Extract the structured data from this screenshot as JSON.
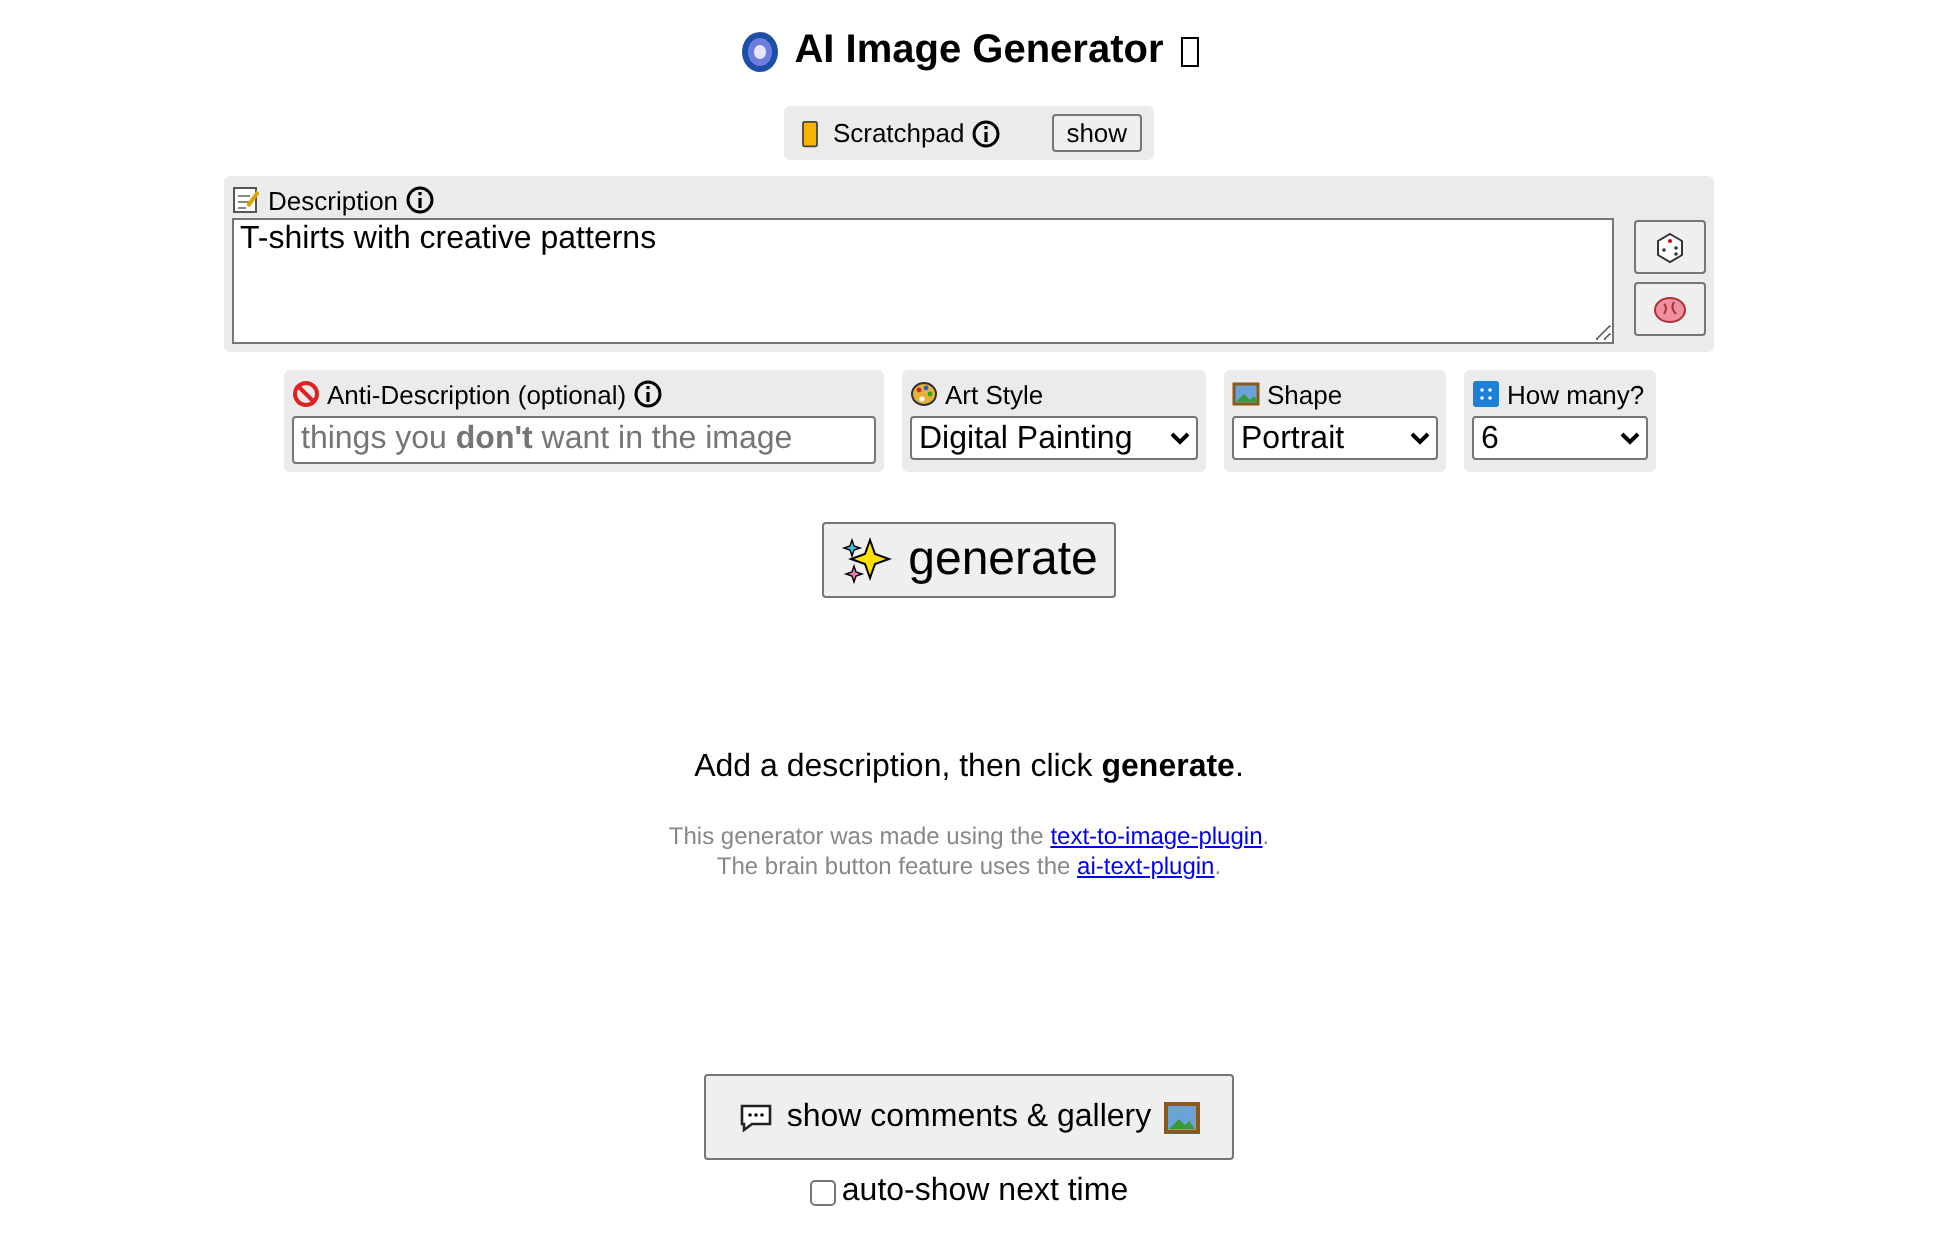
{
  "title": "AI Image Generator",
  "scratchpad": {
    "label": "Scratchpad",
    "button": "show"
  },
  "description": {
    "label": "Description",
    "value": "T-shirts with creative patterns"
  },
  "anti_description": {
    "label": "Anti-Description (optional)",
    "placeholder": "things you **don't** want in the image"
  },
  "art_style": {
    "label": "Art Style",
    "value": "Digital Painting"
  },
  "shape": {
    "label": "Shape",
    "value": "Portrait"
  },
  "how_many": {
    "label": "How many?",
    "value": "6"
  },
  "generate_button": "generate",
  "prompt": "Add a description, then click **generate**.",
  "notes": [
    {
      "text": "This generator was made using the",
      "link": "text-to-image-plugin",
      "after": "."
    },
    {
      "text": "The brain button feature uses the",
      "link": "ai-text-plugin",
      "after": "."
    }
  ],
  "comments_button": "show comments & gallery",
  "auto_show": {
    "label": "auto-show next time",
    "checked": false
  }
}
